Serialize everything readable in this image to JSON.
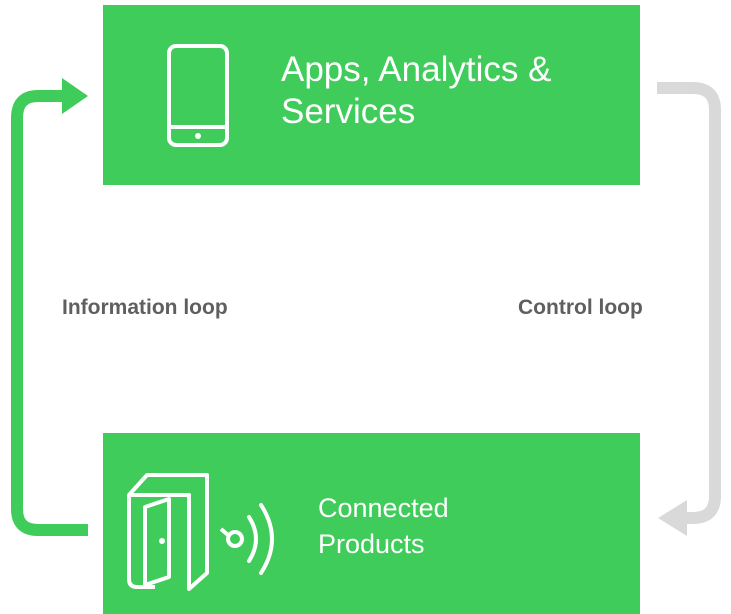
{
  "diagram": {
    "top_box": {
      "title": "Apps, Analytics &\nServices",
      "icon": "smartphone-icon",
      "color": "#3fcc5a"
    },
    "bottom_box": {
      "title": "Connected\nProducts",
      "icon": "connected-door-icon",
      "color": "#3fcc5a"
    },
    "left_loop": {
      "label": "Information loop",
      "color": "#3fcc5a"
    },
    "right_loop": {
      "label": "Control loop",
      "color": "#d9d9d9"
    }
  }
}
